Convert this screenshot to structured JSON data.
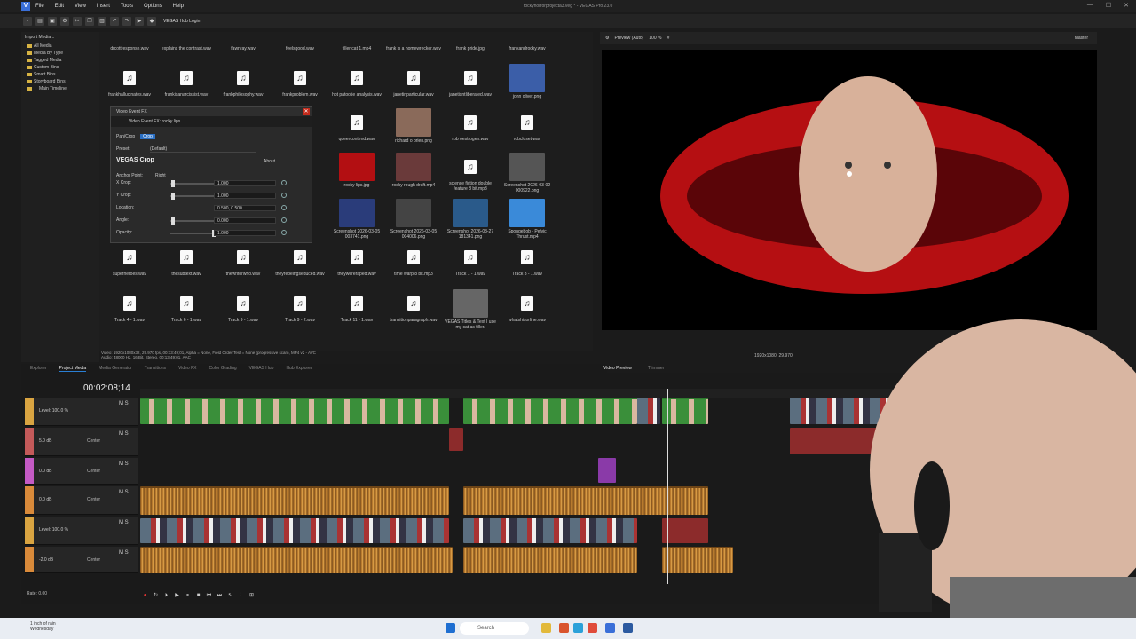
{
  "titlebar": {
    "app_icon": "V",
    "title": "rockyhorrorprojecta3.veg * - VEGAS Pro 23.0",
    "menu": [
      "File",
      "Edit",
      "View",
      "Insert",
      "Tools",
      "Options",
      "Help"
    ],
    "controls": [
      "—",
      "☐",
      "✕"
    ]
  },
  "toolbar": {
    "hub_login": "VEGAS Hub Login"
  },
  "explorer": {
    "import_label": "Import Media...",
    "tree": [
      "All Media",
      "Media By Type",
      "Tagged Media",
      "Custom Bins",
      "Smart Bins",
      "Storyboard Bins",
      "Main Timeline"
    ]
  },
  "media": {
    "rows": [
      [
        "drcottresponse.wav",
        "explains the contrast.wav",
        "fawnray.wav",
        "feelsgood.wav",
        "filler cat 1.mp4",
        "frank is a homewrecker.wav",
        "frank pride.jpg",
        "frankandrocky.wav"
      ],
      [
        "frankhallucinates.wav",
        "frankisanarcissist.wav",
        "frankphilosophy.wav",
        "frankproblem.wav",
        "hot patootie analysis.wav",
        "janetinparticular.wav",
        "janetisntliberated.wav",
        "john oliver.png"
      ],
      [
        "",
        "",
        "",
        "",
        "queercontend.wav",
        "richard o brien.png",
        "rob oestrogen.wav",
        "robcloset.wav"
      ],
      [
        "",
        "",
        "",
        "",
        "",
        "rocky lips.jpg",
        "rocky rough draft.mp4",
        "science fiction double feature 8 bit.mp3",
        "Screenshot 2026-03-02 000922.png"
      ],
      [
        "",
        "",
        "",
        "",
        "Screenshot 2026-03-05 003741.png",
        "Screenshot 2026-03-05 004006.png",
        "Screenshot 2026-03-27 181341.png",
        "Spongebob - Pelvic Thrust.mp4"
      ],
      [
        "superheroes.wav",
        "thesubtext.wav",
        "thewriterwho.wav",
        "theyrebeingseduced.wav",
        "theywereraped.wav",
        "time warp 8 bit.mp3",
        "Track 1 - 1.wav",
        "Track 3 - 1.wav"
      ],
      [
        "Track 4 - 1.wav",
        "Track 6 - 1.wav",
        "Track 9 - 1.wav",
        "Track 9 - 2.wav",
        "Track 11 - 1.wav",
        "transitionparagraph.wav",
        "VEGAS Titles & Text I use my cat as filler.",
        "whatshisorline.wav"
      ]
    ],
    "status_line1": "Video: 1920x1080x32, 29.970 fps, 00:13:49;01, Alpha = None, Field Order Test = None (progressive scan), MP4 v2 - AVC",
    "status_line2": "Audio: 48000 Hz, 16 Bit, Stereo, 00:13:49;01, AAC"
  },
  "fx_dialog": {
    "title": "Video Event FX",
    "chain_label": "Video Event FX: rocky lips",
    "chain_items": [
      "Pan/Crop",
      "Crop"
    ],
    "preset_label": "Preset:",
    "preset_value": "(Default)",
    "plugin_name": "VEGAS Crop",
    "about": "About",
    "anchor_label": "Anchor Point:",
    "anchor_value": "Right",
    "params": [
      {
        "label": "X Crop:",
        "value": "1.000",
        "knob": 0.05
      },
      {
        "label": "Y Crop:",
        "value": "1.000",
        "knob": 0.05
      },
      {
        "label": "Location:",
        "value": "0.500, 0.500",
        "knob": null
      },
      {
        "label": "Angle:",
        "value": "0.000",
        "knob": 0.05
      },
      {
        "label": "Opacity:",
        "value": "1.000",
        "knob": 1.0
      }
    ]
  },
  "preview": {
    "toolbar_mode": "Preview (Auto)",
    "zoom": "100 %",
    "project_info": "1920x1080, 29.970i",
    "master": "Master"
  },
  "tabs": [
    "Explorer",
    "Project Media",
    "Media Generator",
    "Transitions",
    "Video FX",
    "Color Grading",
    "VEGAS Hub",
    "Hub Explorer"
  ],
  "active_tab": "Project Media",
  "preview_tabs": [
    "Video Preview",
    "Trimmer"
  ],
  "timeline": {
    "timecode": "00:02:08;14",
    "rate": "Rate: 0.00",
    "tracks": [
      {
        "label": "Level: 100.0 %",
        "ms": "M S",
        "color": "#d9a441"
      },
      {
        "label": "5.0 dB",
        "extra": "Center",
        "ms": "M S",
        "color": "#c45a5a"
      },
      {
        "label": "0.0 dB",
        "extra": "Center",
        "ms": "M S",
        "color": "#c45ac4"
      },
      {
        "label": "0.0 dB",
        "extra": "Center",
        "ms": "M S",
        "color": "#d98a3a"
      },
      {
        "label": "Level: 100.0 %",
        "ms": "M S",
        "color": "#d9a441"
      },
      {
        "label": "-2.0 dB",
        "extra": "Center",
        "ms": "M S",
        "color": "#d98a3a"
      }
    ]
  },
  "taskbar": {
    "weather_line1": "1 inch of rain",
    "weather_line2": "Wednesday",
    "search": "Search"
  }
}
